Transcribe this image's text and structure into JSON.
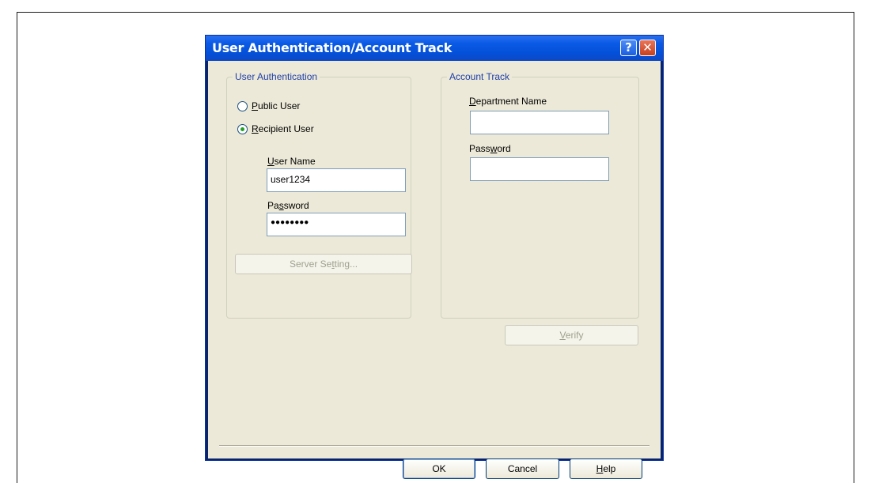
{
  "dialog": {
    "title": "User Authentication/Account Track",
    "help_glyph": "?",
    "close_glyph": "✕"
  },
  "user_auth": {
    "legend": "User Authentication",
    "public_user": {
      "prefix": "",
      "accel": "P",
      "rest": "ublic User",
      "selected": false
    },
    "recipient_user": {
      "prefix": "",
      "accel": "R",
      "rest": "ecipient User",
      "selected": true
    },
    "user_name": {
      "prefix": "",
      "accel": "U",
      "rest": "ser Name",
      "value": "user1234"
    },
    "password": {
      "prefix": "Pa",
      "accel": "s",
      "rest": "sword",
      "value": "●●●●●●●●"
    },
    "server_setting": {
      "prefix": "Server Se",
      "accel": "t",
      "rest": "ting..."
    }
  },
  "account_track": {
    "legend": "Account Track",
    "department_name": {
      "prefix": "",
      "accel": "D",
      "rest": "epartment Name",
      "value": ""
    },
    "password": {
      "prefix": "Pass",
      "accel": "w",
      "rest": "ord",
      "value": ""
    }
  },
  "verify": {
    "prefix": "",
    "accel": "V",
    "rest": "erify"
  },
  "footer": {
    "ok": "OK",
    "cancel": "Cancel",
    "help": {
      "prefix": "",
      "accel": "H",
      "rest": "elp"
    }
  }
}
